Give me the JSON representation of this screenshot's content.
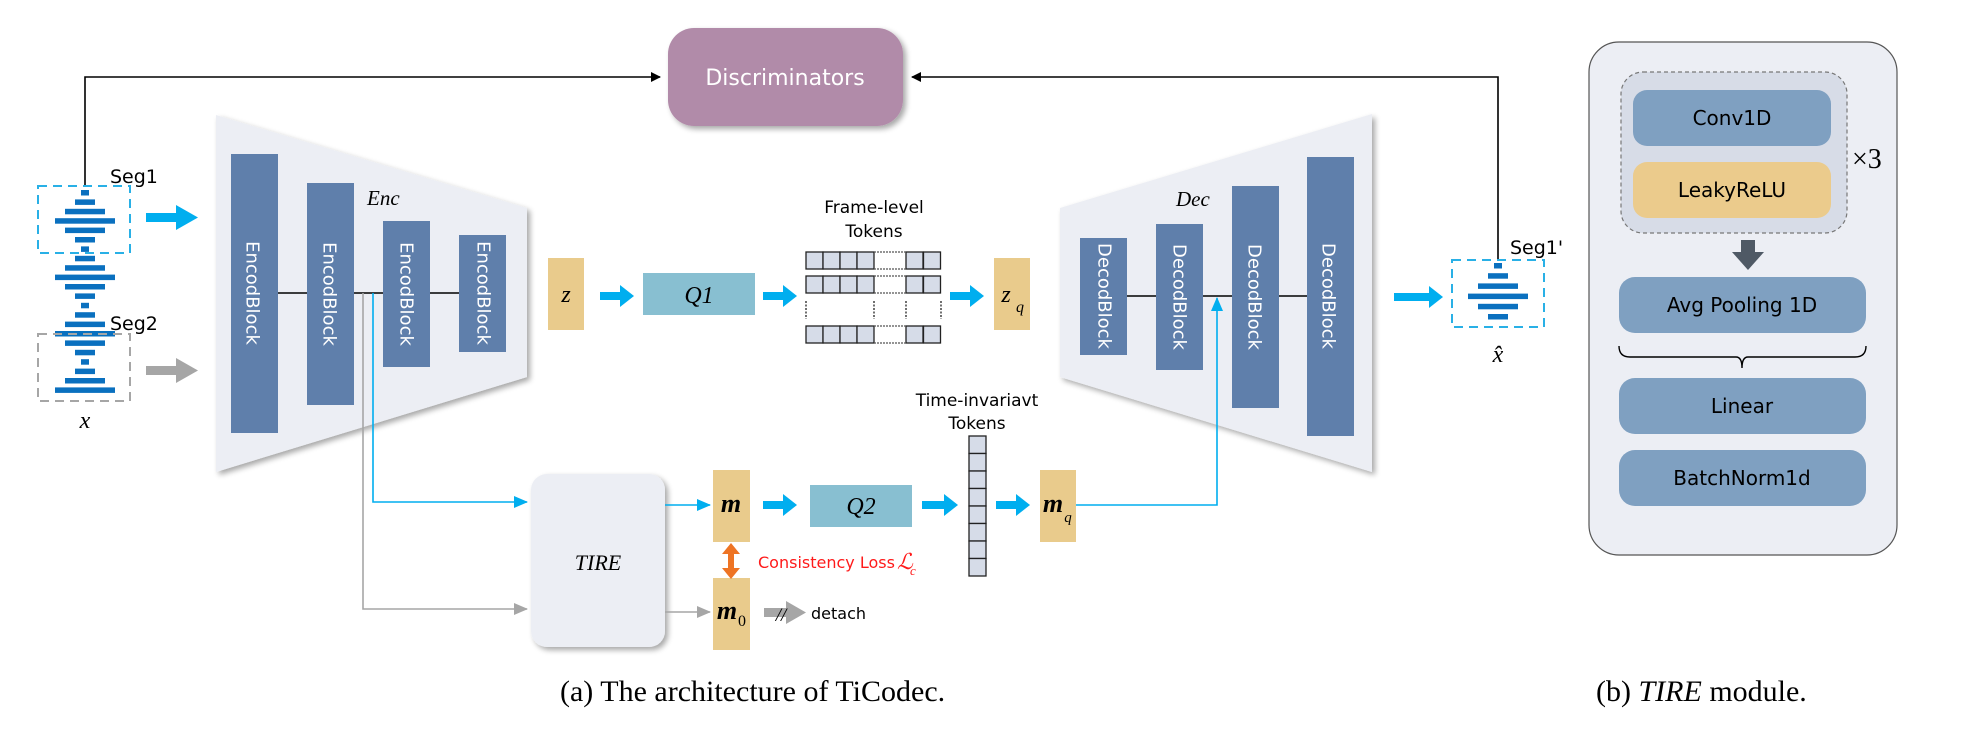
{
  "diagram": {
    "discriminators": {
      "label": "Discriminators"
    },
    "input": {
      "seg1_label": "Seg1",
      "seg2_label": "Seg2",
      "x_label": "x"
    },
    "encoder": {
      "title": "Enc",
      "blocks": [
        "EncodBlock",
        "EncodBlock",
        "EncodBlock",
        "EncodBlock"
      ]
    },
    "z_label": "z",
    "q1_label": "Q1",
    "frame_tokens": {
      "line1": "Frame-level",
      "line2": "Tokens"
    },
    "zq": {
      "base": "z",
      "sub": "q"
    },
    "decoder": {
      "title": "Dec",
      "blocks": [
        "DecodBlock",
        "DecodBlock",
        "DecodBlock",
        "DecodBlock"
      ]
    },
    "output": {
      "seg1p_label": "Seg1'",
      "xhat_label": "x̂"
    },
    "tire_label": "TIRE",
    "m": {
      "base": "m"
    },
    "m0": {
      "base": "m",
      "sub": "0"
    },
    "q2_label": "Q2",
    "consistency": {
      "text": "Consistency Loss",
      "symbol": "ℒ",
      "sub": "c"
    },
    "detach": {
      "slashes": "//",
      "label": "detach"
    },
    "time_tokens": {
      "line1": "Time-invariavt",
      "line2": "Tokens"
    },
    "mq": {
      "base": "m",
      "sub": "q"
    }
  },
  "tire_module": {
    "repeat_group": [
      "Conv1D",
      "LeakyReLU"
    ],
    "repeat_label": "×3",
    "layers": [
      "Avg Pooling 1D",
      "Linear",
      "BatchNorm1d"
    ]
  },
  "captions": {
    "a": "(a) The architecture of TiCodec.",
    "b_prefix": "(b) ",
    "b_italic": "TIRE",
    "b_suffix": " module."
  },
  "colors": {
    "block_blue": "#5f7fab",
    "trapezoid_fill": "#eceef4",
    "latent_tan": "#e9cb8c",
    "quantizer_teal": "#88bfd1",
    "discriminator_purple": "#b18ba9",
    "arrow_blue": "#00aeef",
    "arrow_gray": "#a6a6a6",
    "wave_blue": "#0a70bf",
    "loss_red": "#ff1a1a",
    "loss_arrow_orange": "#ee7424",
    "token_fill": "#d6dce8",
    "tire_layer_blue": "#7fa0c1",
    "tire_leaky_tan": "#ebcb8c"
  }
}
